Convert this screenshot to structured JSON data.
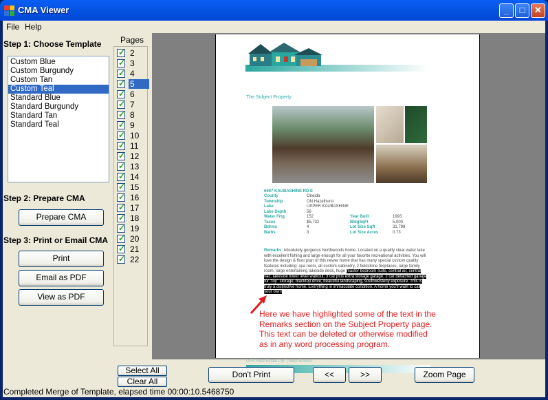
{
  "window": {
    "title": "CMA Viewer"
  },
  "menu": {
    "file": "File",
    "help": "Help"
  },
  "steps": {
    "step1": "Step 1: Choose Template",
    "step2": "Step 2: Prepare CMA",
    "step3": "Step 3: Print or Email CMA"
  },
  "templates": [
    "Custom Blue",
    "Custom Burgundy",
    "Custom Tan",
    "Custom Teal",
    "Standard Blue",
    "Standard Burgundy",
    "Standard Tan",
    "Standard Teal"
  ],
  "selected_template": "Custom Teal",
  "buttons": {
    "prepare": "Prepare CMA",
    "print": "Print",
    "email_pdf": "Email as PDF",
    "view_pdf": "View as PDF",
    "select_all": "Select All",
    "clear_all": "Clear All",
    "dont_print": "Don't Print",
    "prev": "<<",
    "next": ">>",
    "zoom": "Zoom Page"
  },
  "pages": {
    "label": "Pages",
    "items": [
      "2",
      "3",
      "4",
      "5",
      "6",
      "7",
      "8",
      "9",
      "10",
      "11",
      "12",
      "13",
      "14",
      "15",
      "16",
      "17",
      "18",
      "19",
      "20",
      "21",
      "22"
    ],
    "selected": "5"
  },
  "document": {
    "section_title": "The Subject Property",
    "address": "6697 KAUBASHINE RD E",
    "fields": [
      [
        "County",
        "Oneida"
      ],
      [
        "Township",
        "ON Hazelhurst"
      ],
      [
        "Lake",
        "UPPER KAUBASHINE"
      ],
      [
        "Lake Depth",
        "56"
      ],
      [
        "Water Frtg",
        "152"
      ],
      [
        "Taxes",
        "$5,732"
      ],
      [
        "Bdrms",
        "4"
      ],
      [
        "Baths",
        "3"
      ]
    ],
    "fields_right": [
      [
        "Year Built",
        "1993"
      ],
      [
        "BldgSqFt",
        "5,000"
      ],
      [
        "Lot Size Sqft",
        "31,798"
      ],
      [
        "Lot Size Acres",
        "0.73"
      ]
    ],
    "remarks_label": "Remarks",
    "remarks_normal": ": Absolutely gorgeous Northwoods home. Located on a quality clear water lake with excellent fishing and large enough for all your favorite recreational activities. You will love the design & floor plan of this newer home that has many special custom quality features including: spa room, all custom cabinetry, 2 fieldstone fireplaces, large family room, large entertaining lakeside deck, huge",
    "remarks_highlighted": "master bedroom suite, central air, central vac, lakeside lower level walkout, 3 car plus extra storage garage, 2 car detached garage for \"toy\" storage, blacktop drive, beautiful landscaping, southwesterly exposure. This is truly a distinctive home. Everything in immaculate condition. A home you'll want to call your own!",
    "footer": "OFR Real Estate Ltd.  |  Mike Bowles",
    "annotation": "Here we have highlighted some of the text in the Remarks section on the Subject Property page. This text can be deleted or otherwise modified as in any word processing program."
  },
  "status": "Completed Merge of Template, elapsed time 00:00:10.5468750",
  "colors": {
    "accent": "#2aa7a0",
    "selection": "#316ac5",
    "annotation": "#e31b1b"
  }
}
